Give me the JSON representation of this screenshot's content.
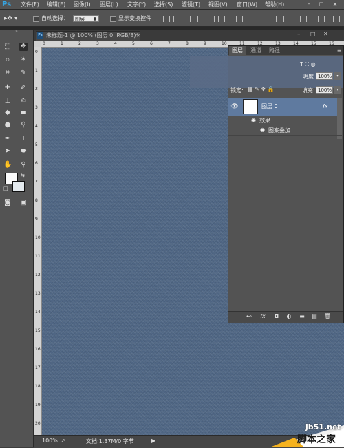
{
  "app": {
    "logo": "Ps"
  },
  "menu": {
    "items": [
      "文件(F)",
      "编辑(E)",
      "图像(I)",
      "图层(L)",
      "文字(Y)",
      "选择(S)",
      "滤镜(T)",
      "视图(V)",
      "窗口(W)",
      "帮助(H)"
    ]
  },
  "options_bar": {
    "auto_select_label": "自动选择：",
    "auto_select_value": "图层",
    "show_transform_label": "显示变换控件"
  },
  "document": {
    "tab_title": "未标题-1 @ 100% (图层 0, RGB/8)",
    "tab_modified_mark": "*",
    "close_symbol": "×"
  },
  "rulers": {
    "top": [
      "0",
      "1",
      "2",
      "3",
      "4",
      "5",
      "6",
      "7",
      "8",
      "9",
      "10",
      "11",
      "12",
      "13",
      "14",
      "15",
      "16"
    ],
    "left": [
      "0",
      "1",
      "2",
      "3",
      "4",
      "5",
      "6",
      "7",
      "8",
      "9",
      "10",
      "11",
      "12",
      "13",
      "14",
      "15",
      "16",
      "17",
      "18",
      "19",
      "20"
    ]
  },
  "status_bar": {
    "zoom": "100%",
    "doc_info": "文档:1.37M/0 字节",
    "arrow": "▶"
  },
  "layers_panel": {
    "tabs": [
      "图层",
      "通道",
      "路径"
    ],
    "active_tab": "图层",
    "opacity_label": "明度:",
    "opacity_value": "100%",
    "lock_label": "锁定:",
    "fill_label": "填充:",
    "fill_value": "100%",
    "layer": {
      "name": "图层 0",
      "fx": "fx"
    },
    "effects_label": "效果",
    "style_label": "图案叠加"
  },
  "watermark": {
    "site": "jb51.net",
    "name": "脚本之家"
  },
  "colors": {
    "canvas": "#4f6684",
    "selected_layer": "#5f7a9f",
    "foreground": "#fafafa",
    "background": "#e4eaee",
    "ps_blue": "#35a8e8"
  }
}
